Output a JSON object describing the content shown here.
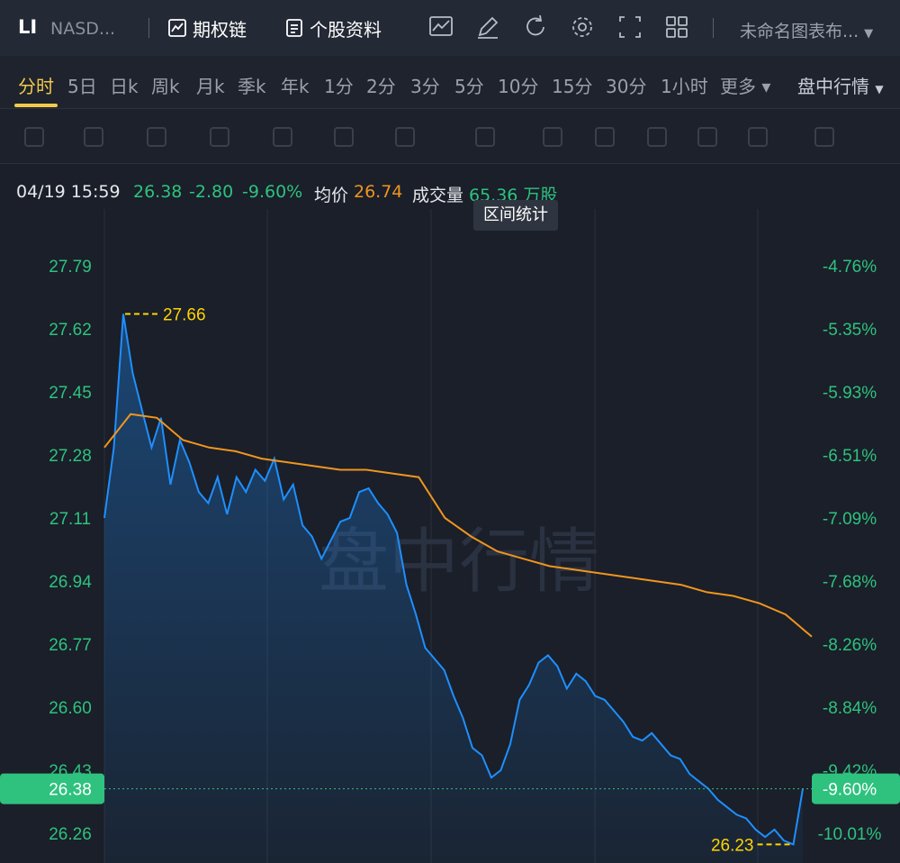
{
  "header": {
    "symbol": "LI",
    "exchange": "NASD...",
    "options_chain_label": "期权链",
    "stock_info_label": "个股资料",
    "layout_name": "未命名图表布..."
  },
  "tabs": [
    "分时",
    "5日",
    "日k",
    "周k",
    "月k",
    "季k",
    "年k",
    "1分",
    "2分",
    "3分",
    "5分",
    "10分",
    "15分",
    "30分",
    "1小时",
    "更多"
  ],
  "active_tab": "分时",
  "intraday_menu": "盘中行情",
  "info": {
    "datetime": "04/19 15:59",
    "price": "26.38",
    "change": "-2.80",
    "change_pct": "-9.60%",
    "avg_label": "均价",
    "avg_value": "26.74",
    "volume_label": "成交量",
    "volume_value": "65.36 万股"
  },
  "tooltip": "区间统计",
  "watermark": "盘中行情",
  "colors": {
    "up": "#2ec27e",
    "price_line": "#1e8fff",
    "avg_line": "#f0951e",
    "highlight": "#ffd400",
    "bg": "#1a1f29"
  },
  "chart_data": {
    "type": "line",
    "y_ticks": [
      "27.79",
      "27.62",
      "27.45",
      "27.28",
      "27.11",
      "26.94",
      "26.77",
      "26.60",
      "26.43",
      "26.26"
    ],
    "y_ticks_pct": [
      "-4.76%",
      "-5.35%",
      "-5.93%",
      "-6.51%",
      "-7.09%",
      "-7.68%",
      "-8.26%",
      "-8.84%",
      "-9.42%",
      "-10.01%"
    ],
    "ylim": [
      26.22,
      27.89
    ],
    "high_label": "27.66",
    "low_label": "26.23",
    "last_price_label": "26.38",
    "last_pct_label": "-9.60%",
    "series": [
      {
        "values": [
          27.11,
          27.3,
          27.66,
          27.5,
          27.4,
          27.3,
          27.38,
          27.2,
          27.32,
          27.26,
          27.18,
          27.15,
          27.22,
          27.12,
          27.22,
          27.18,
          27.24,
          27.21,
          27.27,
          27.16,
          27.2,
          27.09,
          27.06,
          27.0,
          27.05,
          27.1,
          27.11,
          27.18,
          27.19,
          27.15,
          27.12,
          27.07,
          26.93,
          26.85,
          26.76,
          26.73,
          26.7,
          26.63,
          26.57,
          26.49,
          26.47,
          26.41,
          26.43,
          26.5,
          26.62,
          26.66,
          26.72,
          26.74,
          26.71,
          26.65,
          26.69,
          26.67,
          26.63,
          26.62,
          26.59,
          26.56,
          26.52,
          26.51,
          26.53,
          26.5,
          26.47,
          26.46,
          26.42,
          26.4,
          26.38,
          26.35,
          26.33,
          26.31,
          26.3,
          26.27,
          26.25,
          26.27,
          26.24,
          26.23,
          26.38
        ],
        "style": "area"
      },
      {
        "values": [
          27.3,
          27.39,
          27.38,
          27.32,
          27.3,
          27.29,
          27.27,
          27.26,
          27.25,
          27.24,
          27.24,
          27.23,
          27.22,
          27.11,
          27.06,
          27.02,
          27.0,
          26.98,
          26.97,
          26.96,
          26.95,
          26.94,
          26.93,
          26.91,
          26.9,
          26.88,
          26.85,
          26.79
        ],
        "style": "line"
      }
    ]
  }
}
